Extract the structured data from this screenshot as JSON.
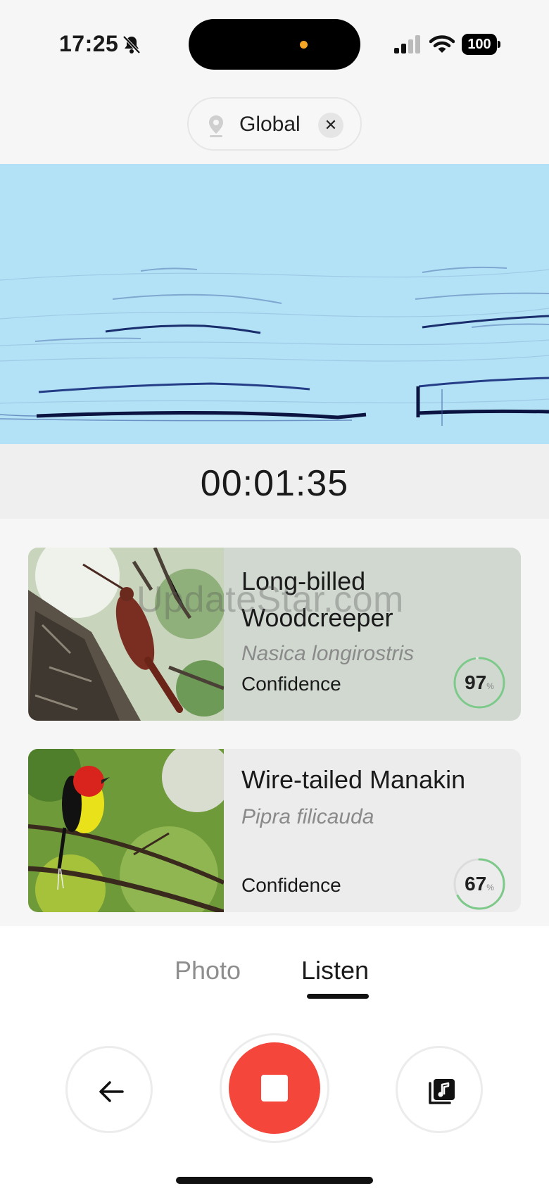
{
  "status_bar": {
    "time": "17:25",
    "battery": "100"
  },
  "location": {
    "label": "Global"
  },
  "recording": {
    "elapsed": "00:01:35"
  },
  "results": [
    {
      "common_name": "Long-billed Woodcreeper",
      "scientific_name": "Nasica longirostris",
      "confidence_label": "Confidence",
      "confidence": "97",
      "confidence_unit": "%",
      "confidence_fraction": 0.97
    },
    {
      "common_name": "Wire-tailed Manakin",
      "scientific_name": "Pipra filicauda",
      "confidence_label": "Confidence",
      "confidence": "67",
      "confidence_unit": "%",
      "confidence_fraction": 0.67
    }
  ],
  "watermark": "UpdateStar.com",
  "tabs": {
    "photo": "Photo",
    "listen": "Listen",
    "active": "Listen"
  },
  "colors": {
    "accent_red": "#f4463b",
    "spectrogram_bg": "#b3e2f7",
    "ring_green": "#7dc98a"
  },
  "icons": {
    "mute": "bell-slash-icon",
    "location": "map-pin-icon",
    "close": "close-icon",
    "back": "arrow-left-icon",
    "stop": "stop-icon",
    "library": "music-library-icon"
  }
}
